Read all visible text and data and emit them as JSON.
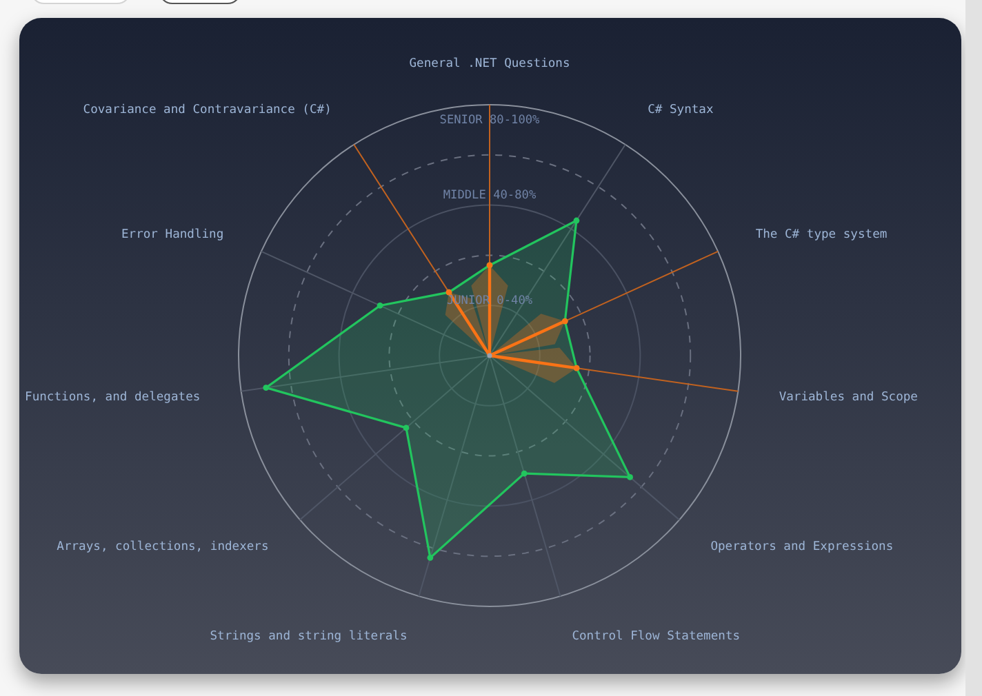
{
  "chart": {
    "axis_labels": [
      "General .NET Questions",
      "Covariance and Contravariance (C#)",
      "C# Syntax",
      "Error Handling",
      "The C# type system",
      "Functions, and delegates",
      "Variables and Scope",
      "Arrays, collections, indexers",
      "Operators and Expressions",
      "Strings and string literals",
      "Control Flow Statements"
    ],
    "level_labels": [
      "SENIOR 80-100%",
      "MIDDLE 40-80%",
      "JUNIOR 0-40%"
    ]
  }
}
